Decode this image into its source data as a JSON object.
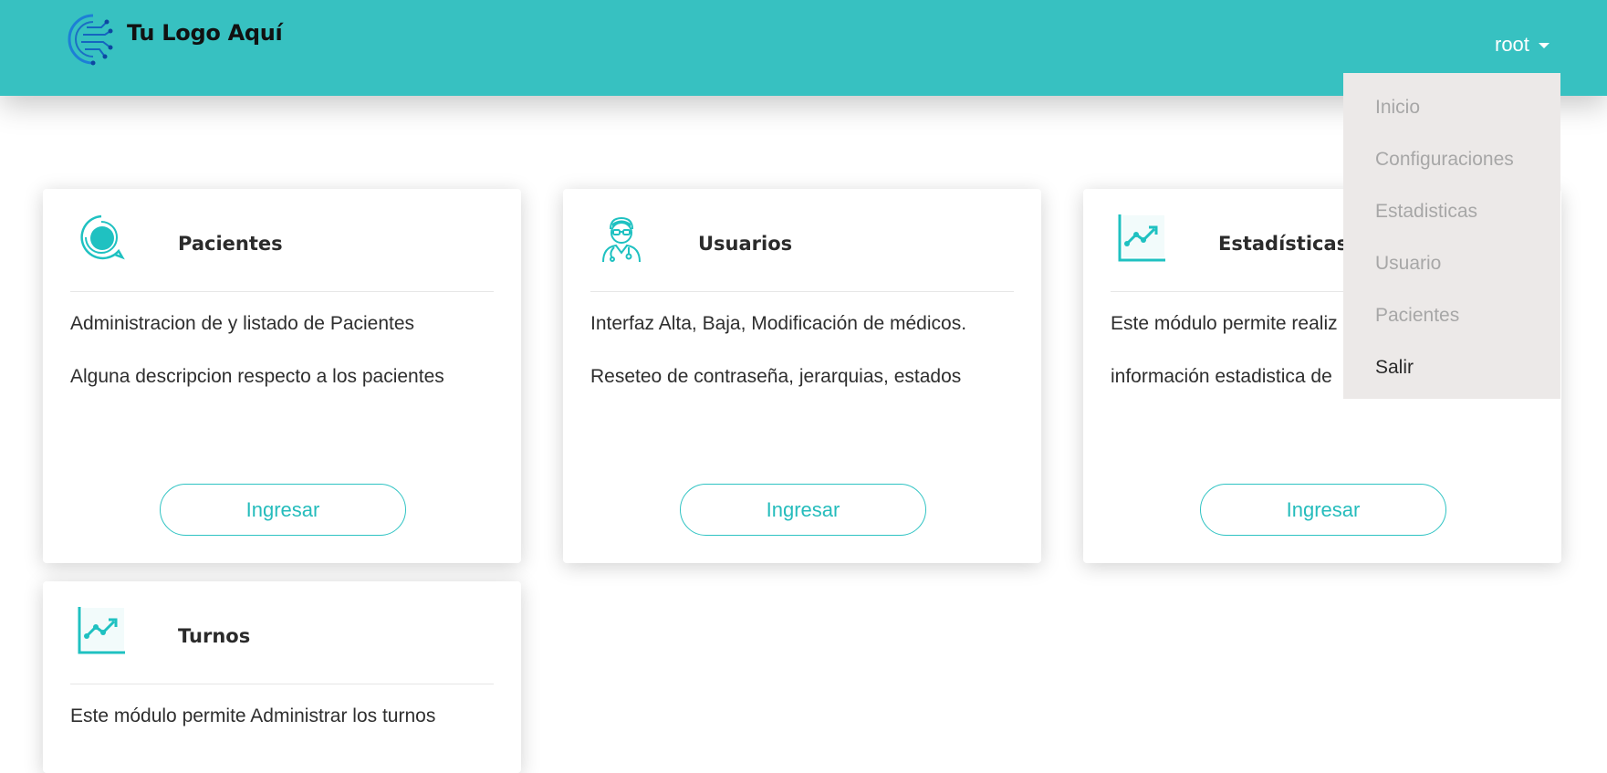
{
  "navbar": {
    "brand_text": "Tu Logo Aquí",
    "user_label": "root"
  },
  "dropdown": {
    "items": [
      {
        "label": "Inicio"
      },
      {
        "label": "Configuraciones"
      },
      {
        "label": "Estadisticas"
      },
      {
        "label": "Usuario"
      },
      {
        "label": "Pacientes"
      },
      {
        "label": "Salir"
      }
    ]
  },
  "cards": [
    {
      "title": "Pacientes",
      "icon": "patient-icon",
      "lines": [
        "Administracion de y listado de Pacientes",
        "Alguna descripcion respecto a los pacientes"
      ],
      "button_label": "Ingresar"
    },
    {
      "title": "Usuarios",
      "icon": "doctor-icon",
      "lines": [
        "Interfaz Alta, Baja, Modificación de médicos.",
        "Reseteo de contraseña, jerarquias, estados"
      ],
      "button_label": "Ingresar"
    },
    {
      "title": "Estadísticas",
      "icon": "chart-icon",
      "lines": [
        "Este módulo permite realiz",
        "información estadistica de"
      ],
      "button_label": "Ingresar"
    },
    {
      "title": "Turnos",
      "icon": "chart-icon",
      "lines": [
        "Este módulo permite Administrar los turnos"
      ]
    }
  ],
  "colors": {
    "navbar": "#37c1c1",
    "accent": "#25bcbc",
    "dropdown_bg": "#ece9e8"
  }
}
